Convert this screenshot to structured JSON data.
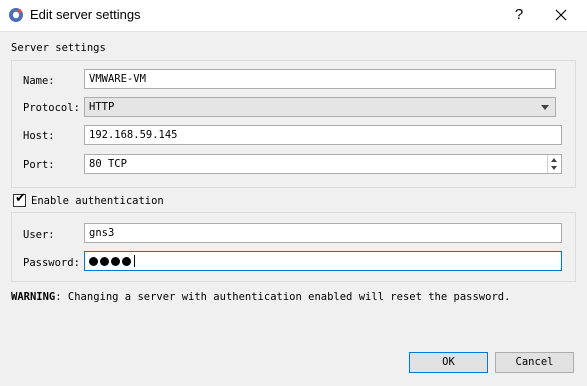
{
  "window": {
    "title": "Edit server settings",
    "help_label": "?",
    "close_label": "✕"
  },
  "server_settings": {
    "group_title": "Server settings",
    "name_label": "Name:",
    "name_value": "VMWARE-VM",
    "protocol_label": "Protocol:",
    "protocol_value": "HTTP",
    "host_label": "Host:",
    "host_value": "192.168.59.145",
    "port_label": "Port:",
    "port_value": "80 TCP"
  },
  "authentication": {
    "enable_label": "Enable authentication",
    "enabled": true,
    "user_label": "User:",
    "user_value": "gns3",
    "password_label": "Password:",
    "password_masked_length": 4
  },
  "warning": {
    "prefix": "WARNING",
    "text": ": Changing a server with authentication enabled will reset the password."
  },
  "buttons": {
    "ok_label": "OK",
    "cancel_label": "Cancel"
  },
  "colors": {
    "focus": "#0078d7",
    "background": "#f0f0f0"
  }
}
